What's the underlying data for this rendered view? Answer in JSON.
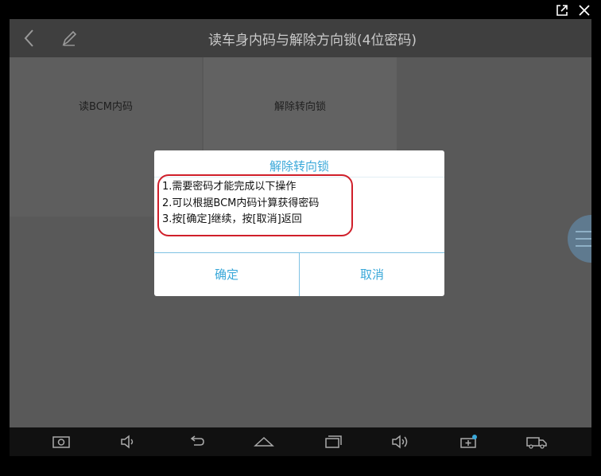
{
  "screen": {
    "title": "读车身内码与解除方向锁(4位密码)"
  },
  "tiles": [
    {
      "label": "读BCM内码"
    },
    {
      "label": "解除转向锁"
    }
  ],
  "dialog": {
    "title": "解除转向锁",
    "lines": [
      "1.需要密码才能完成以下操作",
      "2.可以根据BCM内码计算获得密码",
      "3.按[确定]继续，按[取消]返回"
    ],
    "ok_label": "确定",
    "cancel_label": "取消"
  },
  "icons": {
    "window_popout": "external-window-icon",
    "window_close": "close-icon",
    "back": "back-chevron-icon",
    "edit": "pencil-icon",
    "screenshot": "camera-icon",
    "volume_down": "volume-down-icon",
    "nav_back": "nav-back-icon",
    "home": "home-icon",
    "recents": "recents-icon",
    "volume_up": "volume-up-icon",
    "vci": "vci-icon",
    "truck": "truck-icon"
  },
  "colors": {
    "accent": "#3aa8d9",
    "highlight": "#d01f2a"
  }
}
